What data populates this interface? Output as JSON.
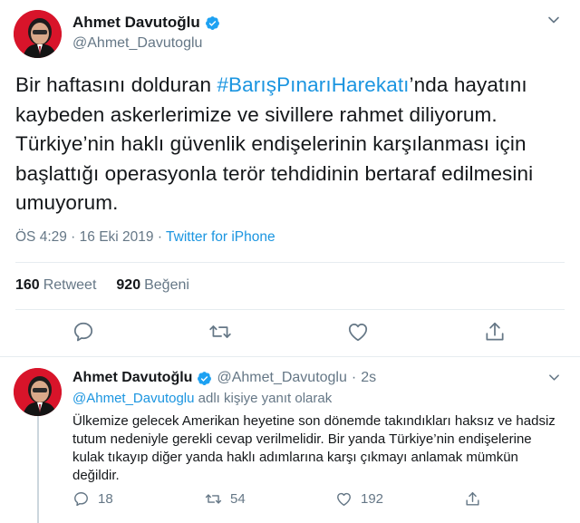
{
  "colors": {
    "text": "#14171a",
    "secondary": "#657786",
    "link": "#1b95e0",
    "verified": "#1da1f2",
    "divider": "#e6ecf0"
  },
  "main_tweet": {
    "author_name": "Ahmet Davutoğlu",
    "handle": "@Ahmet_Davutoglu",
    "text_before": "Bir haftasını dolduran ",
    "hashtag": "#BarışPınarıHarekatı",
    "text_after": "’nda hayatını kaybeden askerlerimize ve sivillere rahmet diliyorum. Türkiye’nin haklı güvenlik endişelerinin karşılanması için başlattığı operasyonla terör tehdidinin bertaraf edilmesini umuyorum.",
    "timestamp": "ÖS 4:29 · 16 Eki 2019 · ",
    "source": "Twitter for iPhone",
    "retweet_count": "160",
    "retweet_label": "Retweet",
    "like_count": "920",
    "like_label": "Beğeni",
    "icons": [
      "reply-icon",
      "retweet-icon",
      "like-icon",
      "share-icon"
    ]
  },
  "reply_tweet": {
    "author_name": "Ahmet Davutoğlu",
    "handle": "@Ahmet_Davutoglu",
    "dot": "·",
    "time": "2s",
    "reply_to_handle": "@Ahmet_Davutoglu",
    "reply_to_suffix": " adlı kişiye yanıt olarak",
    "text": "Ülkemize gelecek Amerikan heyetine son dönemde takındıkları haksız ve hadsiz tutum nedeniyle gerekli cevap verilmelidir. Bir yanda Türkiye’nin endişelerine kulak tıkayıp diğer yanda haklı adımlarına karşı çıkmayı anlamak mümkün değildir.",
    "reply_count": "18",
    "retweet_count": "54",
    "like_count": "192"
  }
}
